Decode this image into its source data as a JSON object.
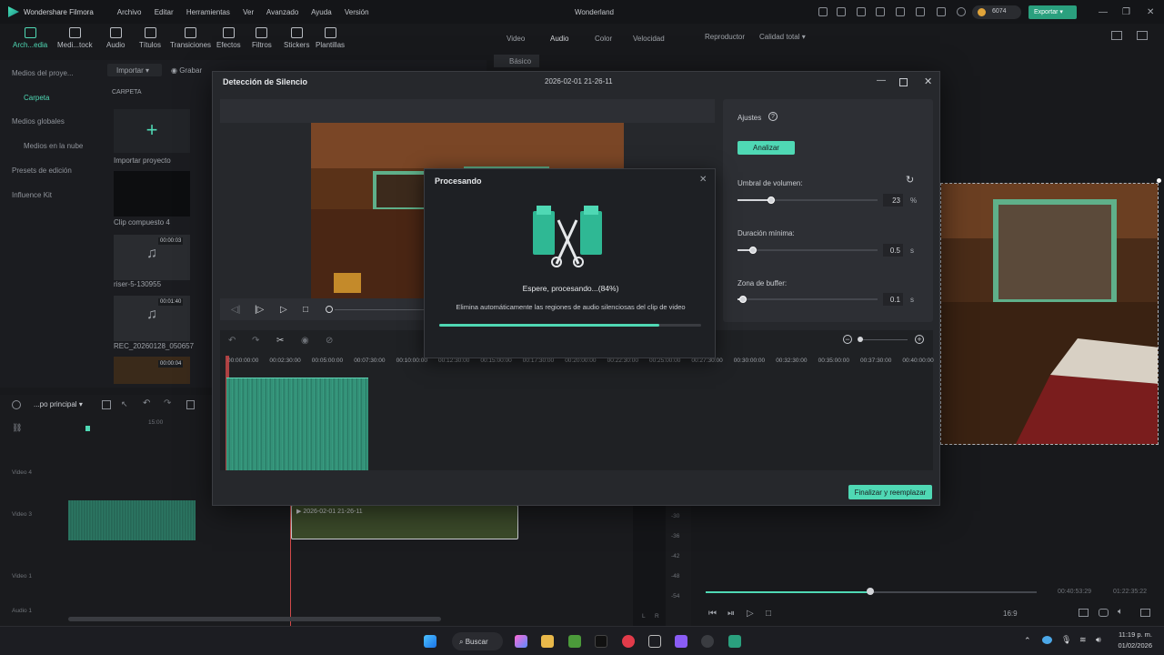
{
  "app": {
    "name": "Wondershare Filmora",
    "window_title": "Wonderland"
  },
  "menu": [
    "Archivo",
    "Editar",
    "Herramientas",
    "Ver",
    "Avanzado",
    "Ayuda",
    "Versión"
  ],
  "credits": "6074",
  "export_label": "Exportar",
  "toolbar": [
    "Arch...edia",
    "Medi...tock",
    "Audio",
    "Títulos",
    "Transiciones",
    "Efectos",
    "Filtros",
    "Stickers",
    "Plantillas"
  ],
  "left_panel": {
    "items": [
      "Medios del proye...",
      "Carpeta",
      "Medios globales",
      "Medios en la nube",
      "Presets de edición",
      "Influence Kit"
    ]
  },
  "media": {
    "import_label": "Importar",
    "record_label": "Grabar",
    "folder_label": "CARPETA",
    "items": [
      {
        "name": "Importar proyecto",
        "duration": ""
      },
      {
        "name": "Clip compuesto 4",
        "duration": ""
      },
      {
        "name": "riser-5-130955",
        "duration": "00:00:03"
      },
      {
        "name": "REC_20260128_050657",
        "duration": "00:01:40"
      },
      {
        "name": "",
        "duration": "00:00:04"
      }
    ]
  },
  "prop_tabs": [
    "Video",
    "Audio",
    "Color",
    "Velocidad"
  ],
  "prop_subtab": "Básico",
  "player": {
    "label": "Reproductor",
    "quality": "Calidad total",
    "time_current": "00:40:53:29",
    "time_total": "01:22:35:22",
    "ratio": "16:9"
  },
  "dialog": {
    "title": "Detección de Silencio",
    "timestamp": "2026-02-01 21-26-11",
    "settings_title": "Ajustes",
    "analyze_label": "Analizar",
    "volume_label": "Umbral de volumen:",
    "volume_value": "23",
    "volume_unit": "%",
    "volume_frac": 0.24,
    "min_duration_label": "Duración mínima:",
    "min_duration_value": "0.5",
    "min_duration_unit": "s",
    "min_duration_frac": 0.11,
    "buffer_label": "Zona de buffer:",
    "buffer_value": "0.1",
    "buffer_unit": "s",
    "buffer_frac": 0.04,
    "ruler": [
      "00:00:00:00",
      "00:02:30:00",
      "00:05:00:00",
      "00:07:30:00",
      "00:10:00:00",
      "00:12:30:00",
      "00:15:00:00",
      "00:17:30:00",
      "00:20:00:00",
      "00:22:30:00",
      "00:25:00:00",
      "00:27:30:00",
      "00:30:00:00",
      "00:32:30:00",
      "00:35:00:00",
      "00:37:30:00",
      "00:40:00:00"
    ],
    "finalize_label": "Finalizar y reemplazar"
  },
  "processing": {
    "title": "Procesando",
    "message": "Espere, procesando...(84%)",
    "description": "Elimina automáticamente las regiones de audio silenciosas del clip de video",
    "progress": 0.84
  },
  "timeline": {
    "group_label": "...po principal",
    "clip_label": "2026-02-01 21-26-11",
    "ruler_mark": "15:00",
    "tracks": [
      "Video 4",
      "Video 3",
      "Video 1",
      "Audio 1"
    ],
    "meter": [
      "-30",
      "-36",
      "-42",
      "-48",
      "-54"
    ],
    "meter_bottom": [
      "L",
      "R"
    ]
  },
  "taskbar": {
    "search": "Buscar",
    "time": "11:19 p. m.",
    "date": "01/02/2026"
  },
  "colors": {
    "accent": "#4fd8b4",
    "bg": "#18191c",
    "dialog": "#26282c"
  }
}
